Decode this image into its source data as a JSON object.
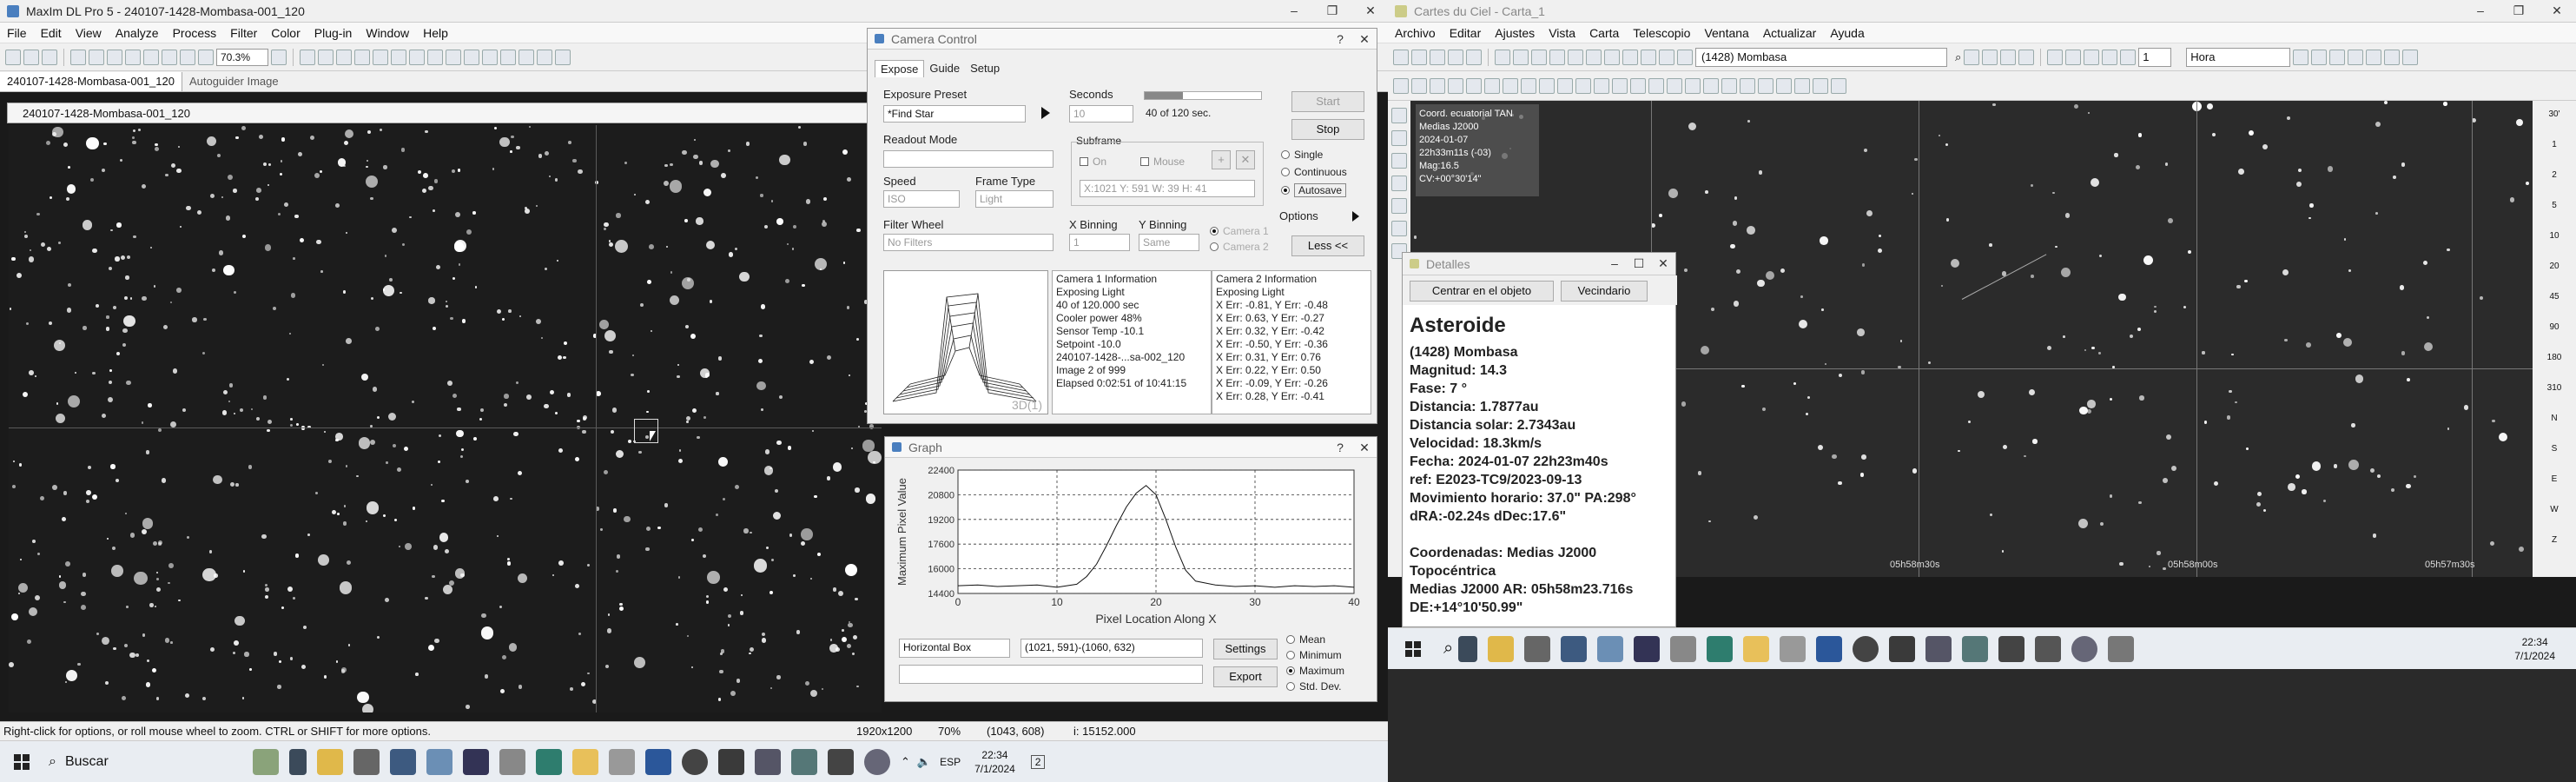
{
  "maxim": {
    "title": "MaxIm DL Pro 5 - 240107-1428-Mombasa-001_120",
    "menu": [
      "File",
      "Edit",
      "View",
      "Analyze",
      "Process",
      "Filter",
      "Color",
      "Plug-in",
      "Window",
      "Help"
    ],
    "zoom": "70.3%",
    "doc_tabs": [
      "240107-1428-Mombasa-001_120",
      "Autoguider Image"
    ],
    "image_window_title": "240107-1428-Mombasa-001_120",
    "status": {
      "hint": "Right-click for options, or roll mouse wheel to zoom. CTRL or SHIFT for more options.",
      "dims": "1920x1200",
      "zoom": "70%",
      "coords": "(1043, 608)",
      "intensity": "i: 15152.000"
    }
  },
  "camera": {
    "title": "Camera Control",
    "tabs": [
      "Expose",
      "Guide",
      "Setup"
    ],
    "exposure_preset_label": "Exposure Preset",
    "exposure_preset_value": "*Find Star",
    "seconds_label": "Seconds",
    "seconds_value": "10",
    "progress_text": "40 of 120 sec.",
    "progress_fraction": 0.33,
    "start": "Start",
    "stop": "Stop",
    "readout_label": "Readout Mode",
    "subframe_label": "Subframe",
    "subframe_on": "On",
    "subframe_mouse": "Mouse",
    "subframe_coords": "X:1021 Y: 591 W: 39 H: 41",
    "speed_label": "Speed",
    "speed_value": "ISO",
    "frame_type_label": "Frame Type",
    "frame_type_value": "Light",
    "filter_label": "Filter Wheel",
    "filter_value": "No Filters",
    "xbin_label": "X Binning",
    "xbin_value": "1",
    "ybin_label": "Y Binning",
    "ybin_value": "Same",
    "cam1": "Camera 1",
    "cam2": "Camera 2",
    "single": "Single",
    "continuous": "Continuous",
    "autosave": "Autosave",
    "options": "Options",
    "less": "Less <<",
    "plot_label": "3D(1)",
    "cam1_info": "Camera 1 Information\nExposing Light\n40 of 120.000 sec\nCooler power 48%\nSensor Temp -10.1\nSetpoint -10.0\n240107-1428-...sa-002_120\nImage 2 of 999\nElapsed 0:02:51 of 10:41:15",
    "cam2_info": "Camera 2 Information\nExposing Light\nX Err: -0.81, Y Err: -0.48\nX Err: 0.63, Y Err: -0.27\nX Err: 0.32, Y Err: -0.42\nX Err: -0.50, Y Err: -0.36\nX Err: 0.31, Y Err: 0.76\nX Err: 0.22, Y Err: 0.50\nX Err: -0.09, Y Err: -0.26\nX Err: 0.28, Y Err: -0.41"
  },
  "graph": {
    "title": "Graph",
    "mode": "Horizontal Box",
    "range": "(1021, 591)-(1060, 632)",
    "settings": "Settings",
    "export": "Export",
    "options": [
      "Mean",
      "Minimum",
      "Maximum",
      "Std. Dev."
    ],
    "selected": "Maximum"
  },
  "chart_data": {
    "type": "line",
    "xlabel": "Pixel Location Along X",
    "ylabel": "Maximum Pixel Value",
    "xlim": [
      0,
      40
    ],
    "ylim": [
      14400,
      22400
    ],
    "xticks": [
      "0",
      "10",
      "20",
      "30",
      "40"
    ],
    "yticks": [
      "14400",
      "16000",
      "17600",
      "19200",
      "20800",
      "22400"
    ],
    "x": [
      0,
      2,
      4,
      6,
      8,
      10,
      12,
      13,
      14,
      15,
      16,
      17,
      18,
      19,
      20,
      21,
      22,
      23,
      24,
      26,
      28,
      30,
      32,
      34,
      36,
      38,
      40
    ],
    "y": [
      14900,
      14950,
      14850,
      14900,
      14950,
      14800,
      15000,
      15500,
      16300,
      17500,
      18800,
      20000,
      20900,
      21400,
      20800,
      19200,
      17400,
      15900,
      15200,
      14950,
      14850,
      14900,
      14800,
      14900,
      14850,
      14900,
      14800
    ]
  },
  "cdc": {
    "title": "Cartes du Ciel - Carta_1",
    "menu": [
      "Archivo",
      "Editar",
      "Ajustes",
      "Vista",
      "Carta",
      "Telescopio",
      "Ventana",
      "Actualizar",
      "Ayuda"
    ],
    "object_combo": "(1428) Mombasa",
    "step_value": "1",
    "unit_value": "Hora",
    "overlay": "Coord. ecuatorial TAN\nMedias J2000\n2024-01-07\n22h33m11s (-03)\nMag:16.5\nCV:+00°30'14\"",
    "ra_labels": [
      "05h58m30s",
      "05h58m00s",
      "05h57m30s"
    ],
    "scale_labels": [
      "30'",
      "1",
      "2",
      "5",
      "10",
      "20",
      "45",
      "90",
      "180",
      "310",
      "N",
      "S",
      "E",
      "W",
      "Z"
    ]
  },
  "details": {
    "title": "Detalles",
    "center_btn": "Centrar en el objeto",
    "neighbors_btn": "Vecindario",
    "heading": "Asteroide",
    "lines": [
      "(1428) Mombasa",
      "Magnitud: 14.3",
      "Fase: 7 °",
      "Distancia: 1.7877au",
      "Distancia solar: 2.7343au",
      "Velocidad: 18.3km/s",
      "Fecha: 2024-01-07 22h23m40s",
      "ref: E2023-TC9/2023-09-13",
      "Movimiento horario: 37.0\" PA:298°",
      "dRA:-02.24s dDec:17.6\"",
      "",
      "Coordenadas: Medias J2000",
      "Topocéntrica",
      "Medias J2000 AR: 05h58m23.716s",
      "DE:+14°10'50.99\""
    ]
  },
  "taskbar1": {
    "search": "Buscar",
    "lang": "ESP",
    "time": "22:34",
    "date": "7/1/2024",
    "badge": "2"
  },
  "taskbar2": {
    "time": "22:34",
    "date": "7/1/2024"
  },
  "colors": {
    "accent": "#4a7fbf",
    "sky": "#1c1c1c",
    "cdc_sky": "#2b2b2b"
  }
}
